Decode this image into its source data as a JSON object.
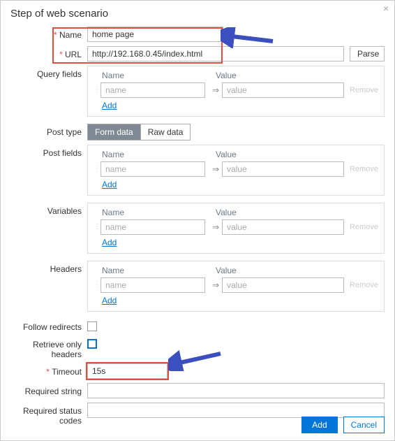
{
  "dialog": {
    "title": "Step of web scenario",
    "close_glyph": "×"
  },
  "labels": {
    "name": "Name",
    "url": "URL",
    "query_fields": "Query fields",
    "post_type": "Post type",
    "post_fields": "Post fields",
    "variables": "Variables",
    "headers": "Headers",
    "follow_redirects": "Follow redirects",
    "retrieve_only_headers": "Retrieve only headers",
    "timeout": "Timeout",
    "required_string": "Required string",
    "required_status_codes": "Required status codes"
  },
  "fields": {
    "name": "home page",
    "url": "http://192.168.0.45/index.html",
    "timeout": "15s",
    "required_string": "",
    "required_status_codes": ""
  },
  "buttons": {
    "parse": "Parse",
    "add": "Add",
    "cancel": "Cancel"
  },
  "post_type": {
    "option_form": "Form data",
    "option_raw": "Raw data"
  },
  "kv": {
    "col_name": "Name",
    "col_value": "Value",
    "name_placeholder": "name",
    "value_placeholder": "value",
    "arrow": "⇒",
    "remove": "Remove",
    "add": "Add"
  }
}
